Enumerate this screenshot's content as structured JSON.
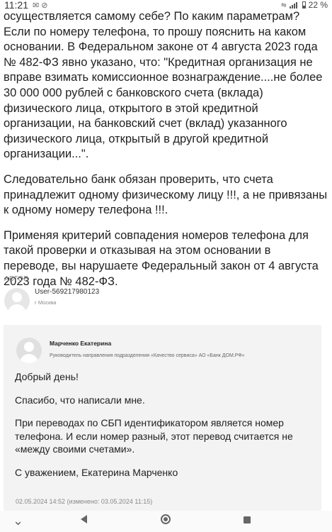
{
  "status_bar": {
    "time": "11:21",
    "notification_icons": "✉ ⊘",
    "battery_percent": "22 %",
    "small_indicator": "⇋"
  },
  "question": {
    "paragraphs": [
      "осуществляется самому себе? По каким параметрам? Если по номеру телефона, то прошу пояснить на каком основании. В Федеральном законе от 4 августа 2023 года № 482-ФЗ явно указано, что: \"Кредитная организация не вправе взимать комиссионное вознаграждение....не более 30 000 000 рублей с банковского счета (вклада) физического лица, открытого в этой кредитной организации, на банковский счет (вклад) указанного физического лица, открытый в другой кредитной организации...\".",
      "Следовательно банк обязан проверить, что счета принадлежит одному физическому лицу !!!, а не привязаны к одному номеру телефона !!!.",
      "Применяя критерий совпадения номеров телефона для такой проверки и отказывая на этом основании в переводе, вы нарушаете Федеральный закон от 4 августа 2023 года № 482-ФЗ."
    ]
  },
  "author": {
    "label": "АВТОР",
    "name": "User-569217980123",
    "city": "г Москва"
  },
  "answer": {
    "name": "Марченко Екатерина",
    "position": "Руководитель направления подразделения «Качество сервиса» АО «Банк ДОМ.РФ»",
    "paragraphs": [
      "Добрый день!",
      "Спасибо, что написали мне.",
      "При переводах по СБП идентификатором является номер телефона. И если номер разный, этот перевод считается не «между своими счетами».",
      "С уважением, Екатерина Марченко"
    ],
    "date": "02.05.2024 14:52 (изменено: 03.05.2024 11:15)"
  },
  "nav": {
    "icons": [
      "chevron-down-icon",
      "back-icon",
      "home-icon",
      "recent-apps-icon"
    ],
    "down_glyph": "⌄"
  }
}
